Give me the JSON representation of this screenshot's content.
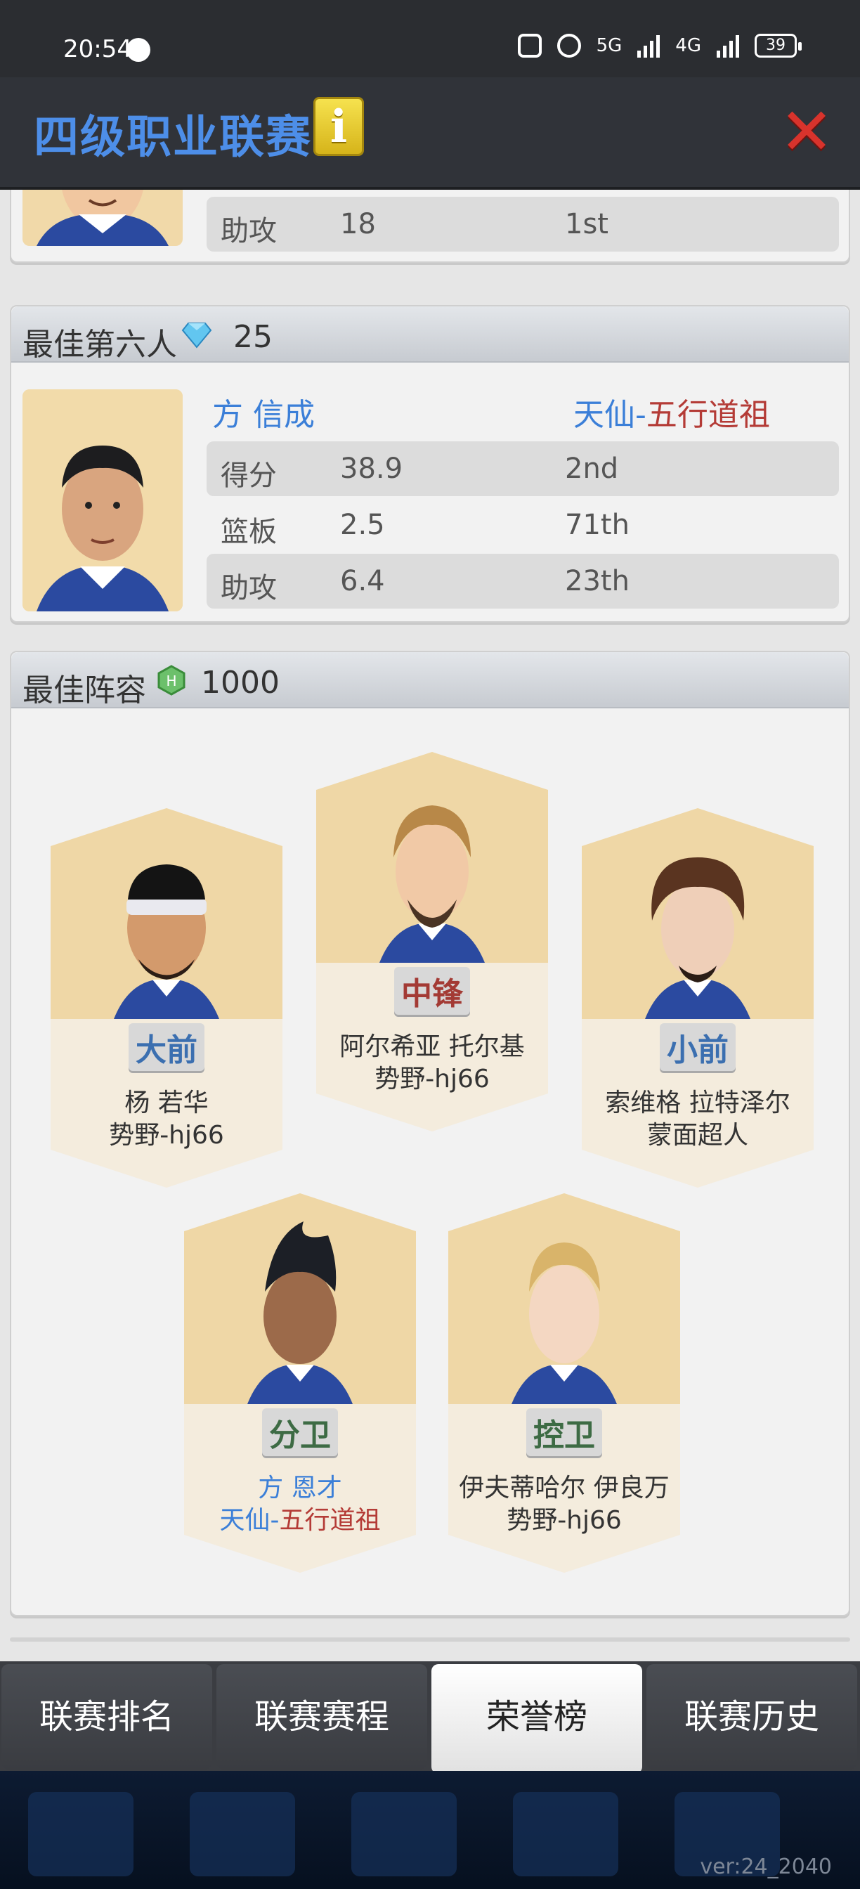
{
  "status_bar": {
    "time": "20:54",
    "network": "5G",
    "network2": "4G",
    "battery": "39"
  },
  "header": {
    "title": "四级职业联赛",
    "info_icon": "i",
    "close_icon": "✕"
  },
  "top_card": {
    "row": {
      "label": "助攻",
      "value": "18",
      "rank": "1st"
    }
  },
  "sixth_man": {
    "title": "最佳第六人",
    "reward_icon": "diamond-icon",
    "reward": "25",
    "player_name": "方 信成",
    "team_prefix": "天仙-",
    "team_suffix": "五行道祖",
    "stats": [
      {
        "label": "得分",
        "value": "38.9",
        "rank": "2nd"
      },
      {
        "label": "篮板",
        "value": "2.5",
        "rank": "71th"
      },
      {
        "label": "助攻",
        "value": "6.4",
        "rank": "23th"
      }
    ]
  },
  "best_lineup": {
    "title": "最佳阵容",
    "reward_icon": "hex-token-icon",
    "reward": "1000",
    "players": [
      {
        "pos": "大前",
        "name": "杨 若华",
        "team": "势野-hj66"
      },
      {
        "pos": "中锋",
        "name": "阿尔希亚 托尔基",
        "team": "势野-hj66"
      },
      {
        "pos": "小前",
        "name": "索维格 拉特泽尔",
        "team": "蒙面超人"
      },
      {
        "pos": "分卫",
        "name": "方 恩才",
        "team_prefix": "天仙-",
        "team_suffix": "五行道祖"
      },
      {
        "pos": "控卫",
        "name": "伊夫蒂哈尔 伊良万",
        "team": "势野-hj66"
      }
    ]
  },
  "tabs": [
    "联赛排名",
    "联赛赛程",
    "荣誉榜",
    "联赛历史"
  ],
  "active_tab": "荣誉榜",
  "version": "ver:24_2040",
  "colors": {
    "title_blue": "#4d8ee8",
    "team_red": "#b43b36",
    "close_red": "#d8332c"
  }
}
